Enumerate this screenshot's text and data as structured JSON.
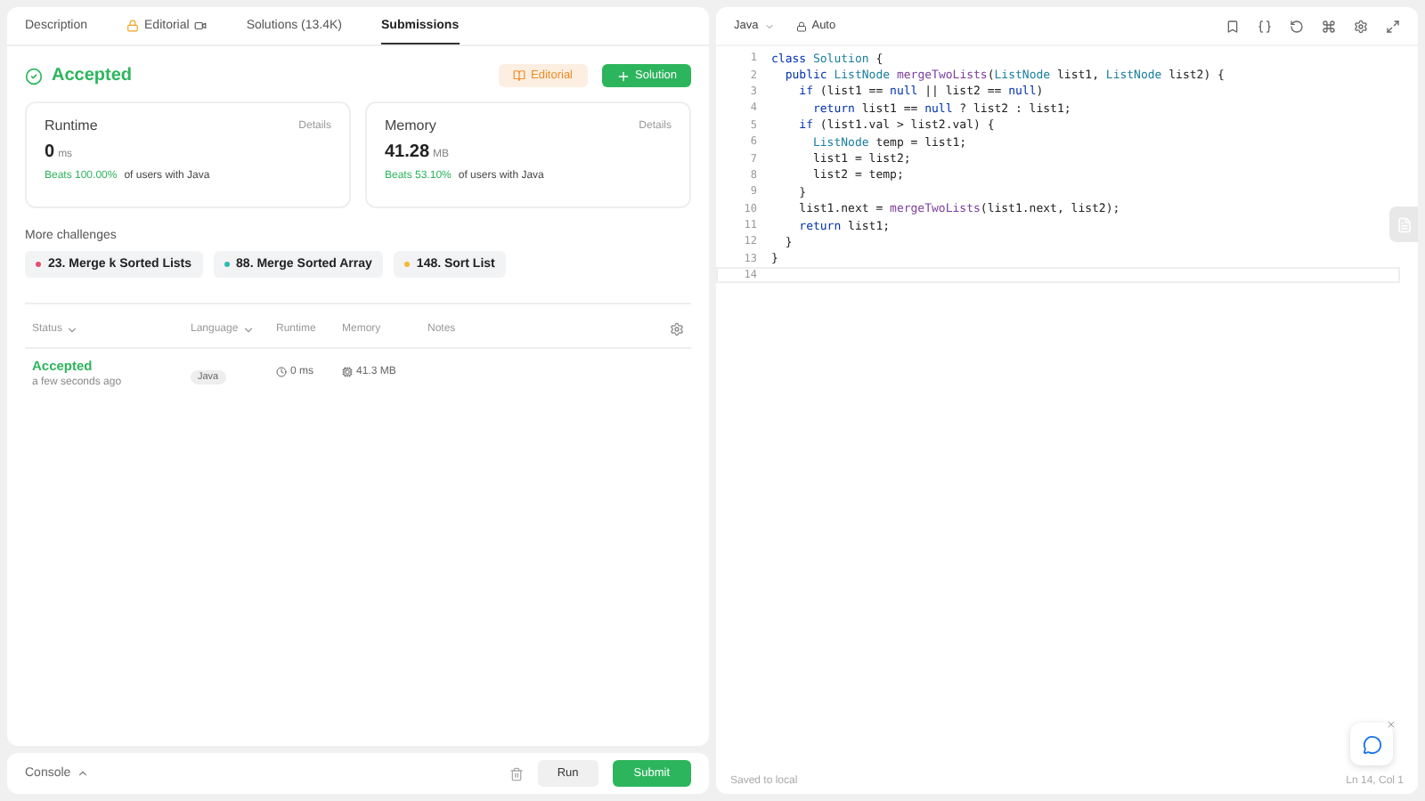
{
  "tabs": [
    {
      "label": "Description",
      "selected": false,
      "kind": "plain"
    },
    {
      "label": "Editorial",
      "selected": false,
      "kind": "locked"
    },
    {
      "label": "Solutions (13.4K)",
      "selected": false,
      "kind": "plain"
    },
    {
      "label": "Submissions",
      "selected": true,
      "kind": "plain"
    }
  ],
  "result": {
    "status": "Accepted",
    "editorial_button": "Editorial",
    "solution_button": "Solution"
  },
  "stats": [
    {
      "title": "Runtime",
      "details": "Details",
      "value": "0",
      "unit": "ms",
      "beats": "Beats 100.00%",
      "suffix": "of users with Java"
    },
    {
      "title": "Memory",
      "details": "Details",
      "value": "41.28",
      "unit": "MB",
      "beats": "Beats 53.10%",
      "suffix": "of users with Java"
    }
  ],
  "more_challenges": {
    "title": "More challenges",
    "items": [
      {
        "label": "23. Merge k Sorted Lists",
        "color": "#e0506e"
      },
      {
        "label": "88. Merge Sorted Array",
        "color": "#2cbbb0"
      },
      {
        "label": "148. Sort List",
        "color": "#f5b82e"
      }
    ]
  },
  "table": {
    "columns": [
      {
        "label": "Status",
        "sortable": true
      },
      {
        "label": "Language",
        "sortable": true
      },
      {
        "label": "Runtime",
        "sortable": false
      },
      {
        "label": "Memory",
        "sortable": false
      },
      {
        "label": "Notes",
        "sortable": false
      }
    ],
    "rows": [
      {
        "status": "Accepted",
        "time": "a few seconds ago",
        "language": "Java",
        "runtime": "0 ms",
        "memory": "41.3 MB"
      }
    ]
  },
  "console": {
    "label": "Console",
    "run": "Run",
    "submit": "Submit"
  },
  "editor": {
    "language": "Java",
    "mode": "Auto",
    "lines": [
      [
        {
          "text": "class ",
          "kind": "kw"
        },
        {
          "text": "Solution",
          "kind": "type"
        },
        {
          "text": " {",
          "kind": "plain"
        }
      ],
      [
        {
          "text": "  public ",
          "kind": "kw"
        },
        {
          "text": "ListNode ",
          "kind": "type"
        },
        {
          "text": "mergeTwoLists",
          "kind": "fn"
        },
        {
          "text": "(",
          "kind": "plain"
        },
        {
          "text": "ListNode ",
          "kind": "type"
        },
        {
          "text": "list1, ",
          "kind": "plain"
        },
        {
          "text": "ListNode ",
          "kind": "type"
        },
        {
          "text": "list2) {",
          "kind": "plain"
        }
      ],
      [
        {
          "text": "    if ",
          "kind": "kw"
        },
        {
          "text": "(list1 == ",
          "kind": "plain"
        },
        {
          "text": "null",
          "kind": "kw"
        },
        {
          "text": " || list2 == ",
          "kind": "plain"
        },
        {
          "text": "null",
          "kind": "kw"
        },
        {
          "text": ")",
          "kind": "plain"
        }
      ],
      [
        {
          "text": "      return ",
          "kind": "kw"
        },
        {
          "text": "list1 == ",
          "kind": "plain"
        },
        {
          "text": "null",
          "kind": "kw"
        },
        {
          "text": " ? list2 : list1;",
          "kind": "plain"
        }
      ],
      [
        {
          "text": "    if ",
          "kind": "kw"
        },
        {
          "text": "(list1.val > list2.val) {",
          "kind": "plain"
        }
      ],
      [
        {
          "text": "      ListNode ",
          "kind": "type"
        },
        {
          "text": "temp = list1;",
          "kind": "plain"
        }
      ],
      [
        {
          "text": "      list1 = list2;",
          "kind": "plain"
        }
      ],
      [
        {
          "text": "      list2 = temp;",
          "kind": "plain"
        }
      ],
      [
        {
          "text": "    }",
          "kind": "plain"
        }
      ],
      [
        {
          "text": "    list1.next = ",
          "kind": "plain"
        },
        {
          "text": "mergeTwoLists",
          "kind": "fn"
        },
        {
          "text": "(list1.next, list2);",
          "kind": "plain"
        }
      ],
      [
        {
          "text": "    return ",
          "kind": "kw"
        },
        {
          "text": "list1;",
          "kind": "plain"
        }
      ],
      [
        {
          "text": "  }",
          "kind": "plain"
        }
      ],
      [
        {
          "text": "}",
          "kind": "plain"
        }
      ]
    ],
    "line_numbers": [
      "1",
      "2",
      "3",
      "4",
      "5",
      "6",
      "7",
      "8",
      "9",
      "10",
      "11",
      "12",
      "13",
      "14"
    ],
    "saved": "Saved to local",
    "position": "Ln 14, Col 1"
  }
}
